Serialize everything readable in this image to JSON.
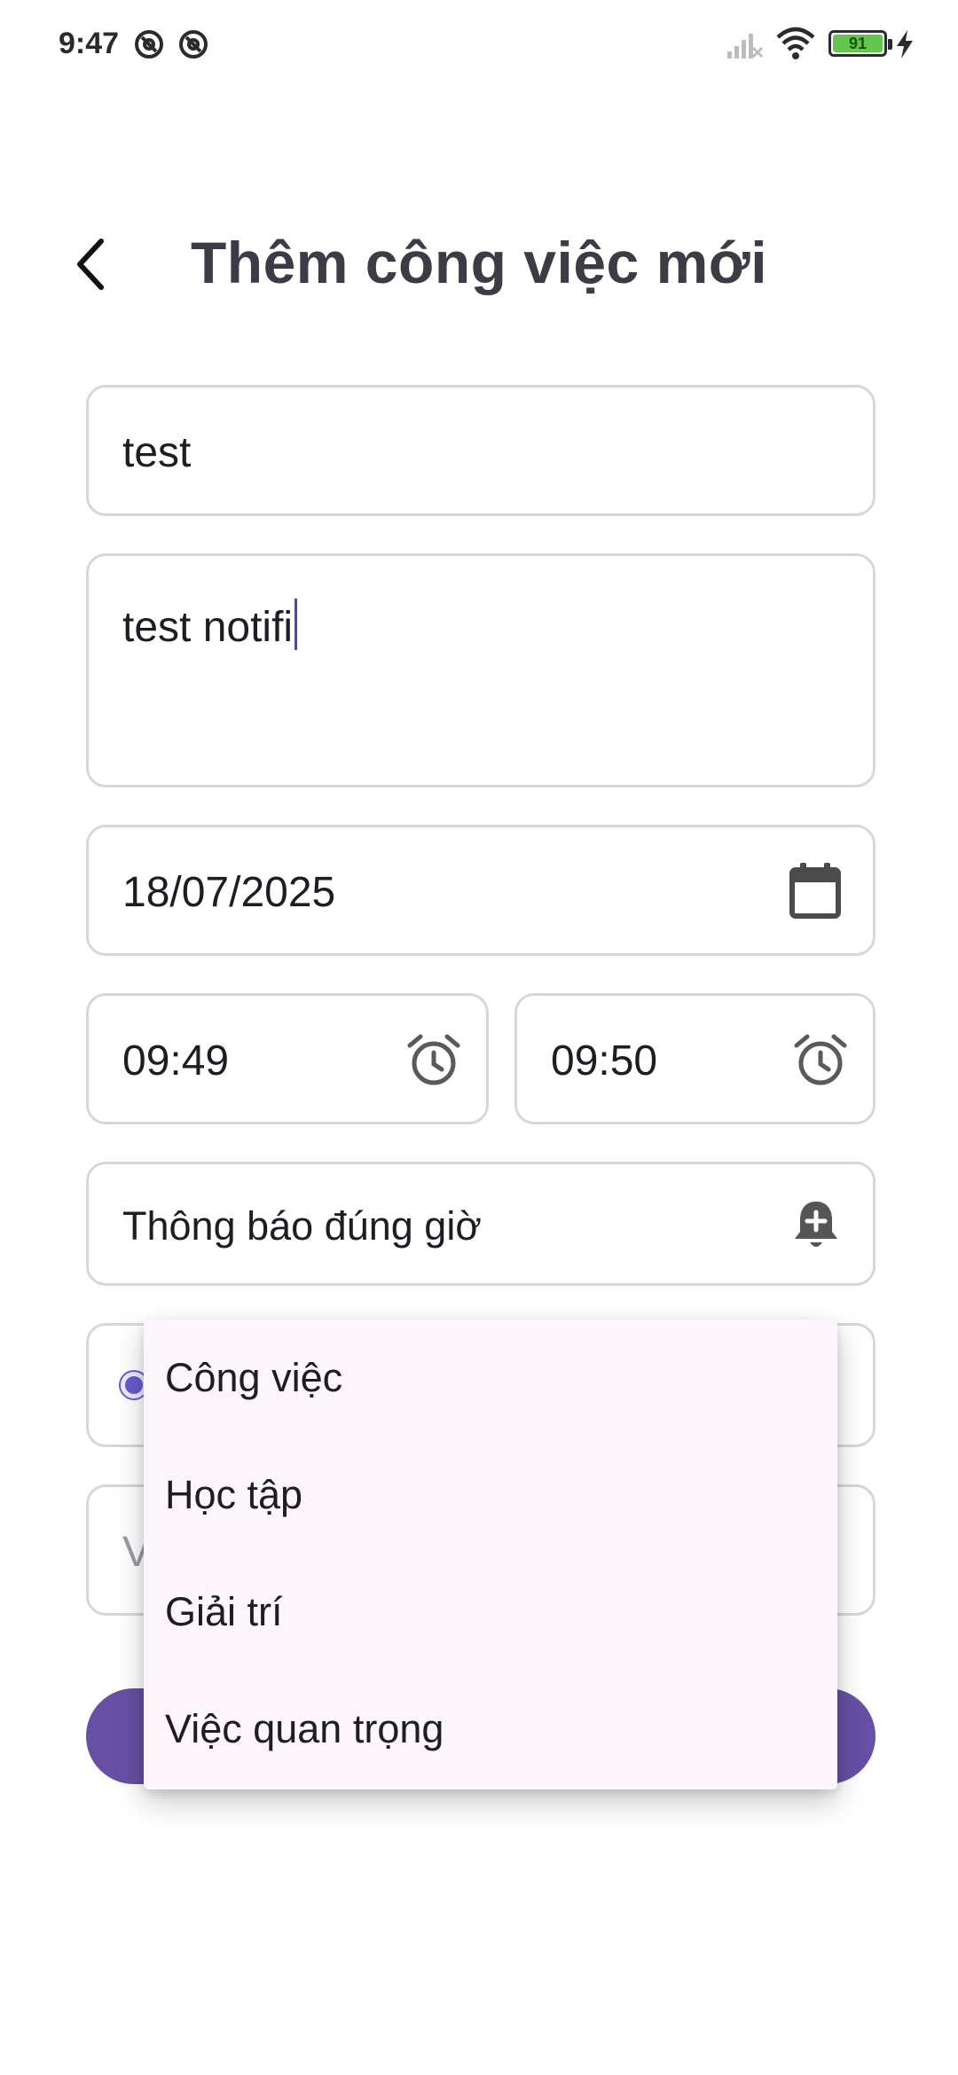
{
  "status_bar": {
    "time": "9:47",
    "notification_icons": [
      "at-sign-icon",
      "at-sign-icon"
    ],
    "signal_icon": "signal-off-icon",
    "wifi_icon": "wifi-icon",
    "battery_level": "91",
    "charging_icon": "bolt-icon"
  },
  "header": {
    "back_icon": "chevron-left-icon",
    "title": "Thêm công việc mới"
  },
  "form": {
    "title_value": "test",
    "description_value": "test notifi",
    "date_value": "18/07/2025",
    "date_icon": "calendar-icon",
    "start_time_value": "09:49",
    "end_time_value": "09:50",
    "time_icon": "alarm-clock-icon",
    "notification_value": "Thông báo đúng giờ",
    "notification_icon": "bell-plus-icon",
    "category_selected_indicator": "radio-selected-icon",
    "extra_field_visible_fragment": "V"
  },
  "dropdown": {
    "items": [
      "Công việc",
      "Học tập",
      "Giải trí",
      "Việc quan trọng"
    ]
  },
  "colors": {
    "accent": "#6750a4",
    "radio": "#6a5acd",
    "menu_background": "#fcf5fc",
    "field_border": "#d8d6dc",
    "battery": "#63c64e"
  }
}
